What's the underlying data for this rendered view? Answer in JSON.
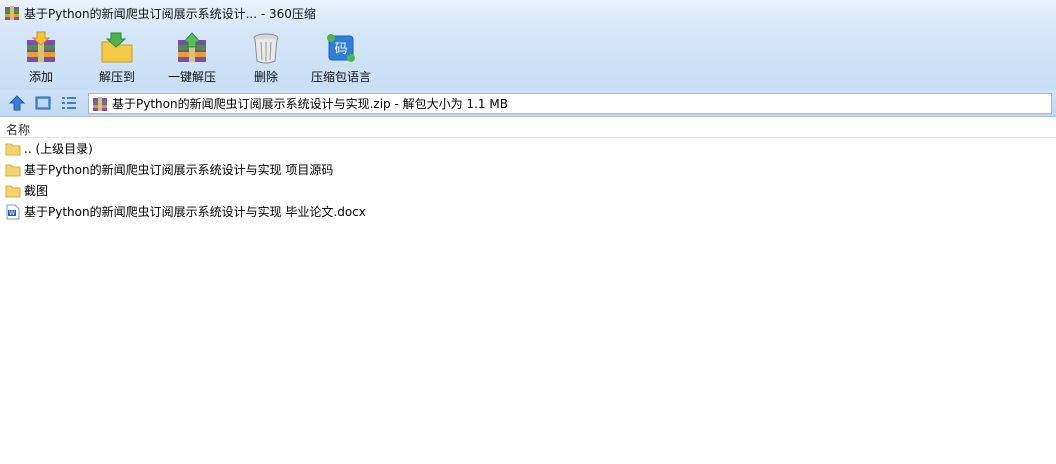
{
  "window": {
    "title": "基于Python的新闻爬虫订阅展示系统设计... - 360压缩"
  },
  "toolbar": {
    "add": "添加",
    "extract_to": "解压到",
    "one_click_extract": "一键解压",
    "delete": "删除",
    "language": "压缩包语言",
    "language_icon_char": "码"
  },
  "address": {
    "path": "基于Python的新闻爬虫订阅展示系统设计与实现.zip - 解包大小为 1.1 MB"
  },
  "columns": {
    "name": "名称"
  },
  "files": [
    {
      "name": ".. (上级目录)",
      "icon": "folder-icon"
    },
    {
      "name": "基于Python的新闻爬虫订阅展示系统设计与实现 项目源码",
      "icon": "folder-icon"
    },
    {
      "name": "截图",
      "icon": "folder-icon"
    },
    {
      "name": "基于Python的新闻爬虫订阅展示系统设计与实现 毕业论文.docx",
      "icon": "word-document-icon",
      "icon_char": "W"
    }
  ],
  "colors": {
    "accent": "#3a7fd5",
    "folder": "#f5d36b"
  }
}
